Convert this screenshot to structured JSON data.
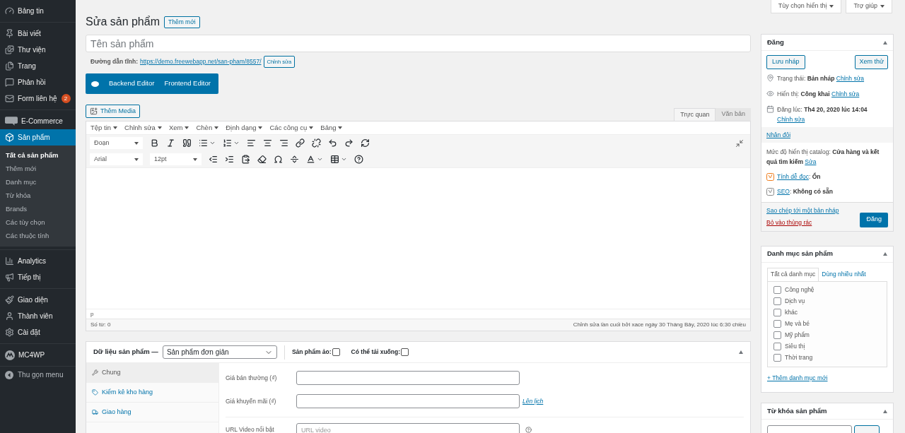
{
  "sidebar": {
    "groups": [
      {
        "items": [
          {
            "label": "Bảng tin",
            "selected": false
          }
        ]
      },
      {
        "items": [
          {
            "label": "Bài viết",
            "selected": false
          },
          {
            "label": "Thư viện",
            "selected": false
          },
          {
            "label": "Trang",
            "selected": false
          },
          {
            "label": "Phản hồi",
            "selected": false
          },
          {
            "label": "Form liên hệ",
            "selected": false,
            "badge": "2"
          }
        ]
      },
      {
        "items": [
          {
            "label": "E-Commerce",
            "selected": false
          },
          {
            "label": "Sản phẩm",
            "selected": true,
            "submenu": [
              {
                "label": "Tất cả sản phẩm",
                "selected": true
              },
              {
                "label": "Thêm mới",
                "selected": false
              },
              {
                "label": "Danh mục",
                "selected": false
              },
              {
                "label": "Từ khóa",
                "selected": false
              },
              {
                "label": "Brands",
                "selected": false
              },
              {
                "label": "Các tùy chọn",
                "selected": false
              },
              {
                "label": "Các thuộc tính",
                "selected": false
              }
            ]
          }
        ]
      },
      {
        "items": [
          {
            "label": "Analytics",
            "selected": false
          },
          {
            "label": "Tiếp thị",
            "selected": false
          }
        ]
      },
      {
        "items": [
          {
            "label": "Giao diện",
            "selected": false
          },
          {
            "label": "Thành viên",
            "selected": false
          },
          {
            "label": "Cài đặt",
            "selected": false
          }
        ]
      },
      {
        "items": [
          {
            "label": "MC4WP",
            "selected": false
          }
        ]
      }
    ],
    "collapse": "Thu gọn menu"
  },
  "screen_meta": [
    "Tùy chọn hiển thị",
    "Trợ giúp"
  ],
  "page": {
    "title": "Sửa sản phẩm",
    "add_new": "Thêm mới"
  },
  "title_field": {
    "placeholder": "Tên sản phẩm"
  },
  "permalink": {
    "label": "Đường dẫn tĩnh:",
    "url": "https://demo.freewebapp.net/san-pham/8557/",
    "edit": "Chỉnh sửa"
  },
  "builder": [
    "Backend Editor",
    "Frontend Editor"
  ],
  "add_media": "Thêm Media",
  "editor_tabs": [
    {
      "label": "Trực quan",
      "selected": true
    },
    {
      "label": "Văn bản",
      "selected": false
    }
  ],
  "menu_bar": [
    "Tệp tin",
    "Chỉnh sửa",
    "Xem",
    "Chèn",
    "Định dạng",
    "Các công cụ",
    "Bảng"
  ],
  "format_select": "Đoạn",
  "font_select": "Arial",
  "size_select": "12pt",
  "path": "p",
  "word_count": "Số từ: 0",
  "last_edit": "Chỉnh sửa lần cuối bởi xace ngày 30 Tháng Bảy, 2020 lúc 6:30 chiều",
  "product_data": {
    "title": "Dữ liệu sản phẩm —",
    "type": "Sản phẩm đơn giản",
    "options": [
      {
        "label": "Sản phẩm ảo:",
        "checked": false
      },
      {
        "label": "Có thể tải xuống:",
        "checked": false
      }
    ],
    "tabs": [
      {
        "label": "Chung",
        "selected": true
      },
      {
        "label": "Kiểm kê kho hàng",
        "selected": false
      },
      {
        "label": "Giao hàng",
        "selected": false
      }
    ],
    "fields": [
      {
        "label": "Giá bán thường (₫)"
      },
      {
        "label": "Giá khuyến mãi (₫)",
        "link": "Lên lịch"
      },
      {
        "label": "URL Video nổi bật",
        "placeholder": "URL video"
      }
    ]
  },
  "publish": {
    "title": "Đăng",
    "save_draft": "Lưu nháp",
    "preview": "Xem thử",
    "rows": [
      {
        "label": "Trạng thái:",
        "value": "Bản nháp",
        "link": "Chỉnh sửa"
      },
      {
        "label": "Hiển thị:",
        "value": "Công khai",
        "link": "Chỉnh sửa"
      },
      {
        "label": "Đăng lúc:",
        "value": "Th4 20, 2020 lúc 14:04",
        "link": "Chỉnh sửa"
      }
    ],
    "duplicate": "Nhân đôi",
    "catalog": {
      "label": "Mức độ hiển thị catalog:",
      "value": "Cửa hàng và kết quả tìm kiếm",
      "link": "Sửa"
    },
    "scores": [
      {
        "link": "Tính dễ đọc",
        "separator": ":",
        "value": "Ổn",
        "color": "#ee7c1b"
      },
      {
        "link": "SEO",
        "separator": ":",
        "value": "Không có sẵn",
        "color": "#888888"
      }
    ],
    "copy_draft": "Sao chép tới một bản nháp",
    "trash": "Bỏ vào thùng rác",
    "publish": "Đăng"
  },
  "categories": {
    "title": "Danh mục sản phẩm",
    "tabs": [
      {
        "label": "Tất cả danh mục",
        "selected": true
      },
      {
        "label": "Dùng nhiều nhất",
        "selected": false
      }
    ],
    "items": [
      {
        "label": "Công nghệ",
        "checked": false
      },
      {
        "label": "Dịch vụ",
        "checked": false
      },
      {
        "label": "khác",
        "checked": false
      },
      {
        "label": "Mẹ và bé",
        "checked": false
      },
      {
        "label": "Mỹ phẩm",
        "checked": false
      },
      {
        "label": "Siêu thị",
        "checked": false
      },
      {
        "label": "Thời trang",
        "checked": false
      }
    ],
    "add": "+ Thêm danh mục mới"
  },
  "tags": {
    "title": "Từ khóa sản phẩm"
  }
}
